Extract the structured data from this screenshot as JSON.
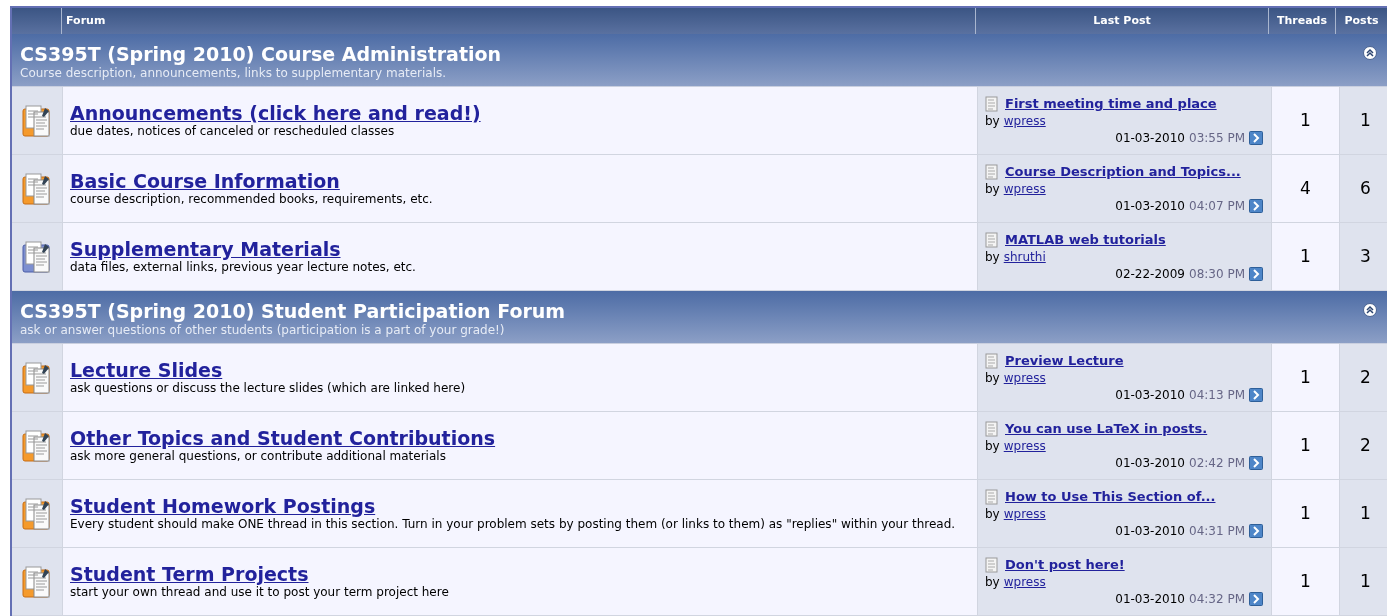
{
  "columns": [
    "Forum",
    "Last Post",
    "Threads",
    "Posts"
  ],
  "categories": [
    {
      "title": "CS395T (Spring 2010) Course Administration",
      "description": "Course description, announcements, links to supplementary materials.",
      "expanded": true,
      "forums": [
        {
          "title": "Announcements (click here and read!)",
          "description": "due dates, notices of canceled or rescheduled classes",
          "new_posts": true,
          "last_post": {
            "title": "First meeting time and place",
            "by": "by",
            "author": "wpress",
            "date": "01-03-2010",
            "time": "03:55 PM"
          },
          "threads": "1",
          "posts": "1"
        },
        {
          "title": "Basic Course Information",
          "description": "course description, recommended books, requirements, etc.",
          "new_posts": true,
          "last_post": {
            "title": "Course Description and Topics...",
            "by": "by",
            "author": "wpress",
            "date": "01-03-2010",
            "time": "04:07 PM"
          },
          "threads": "4",
          "posts": "6"
        },
        {
          "title": "Supplementary Materials",
          "description": "data files, external links, previous year lecture notes, etc.",
          "new_posts": false,
          "last_post": {
            "title": "MATLAB web tutorials",
            "by": "by",
            "author": "shruthi",
            "date": "02-22-2009",
            "time": "08:30 PM"
          },
          "threads": "1",
          "posts": "3"
        }
      ]
    },
    {
      "title": "CS395T (Spring 2010) Student Participation Forum",
      "description": "ask or answer questions of other students (participation is a part of your grade!)",
      "expanded": true,
      "forums": [
        {
          "title": "Lecture Slides",
          "description": "ask questions or discuss the lecture slides (which are linked here)",
          "new_posts": true,
          "last_post": {
            "title": "Preview Lecture",
            "by": "by",
            "author": "wpress",
            "date": "01-03-2010",
            "time": "04:13 PM"
          },
          "threads": "1",
          "posts": "2"
        },
        {
          "title": "Other Topics and Student Contributions",
          "description": "ask more general questions, or contribute additional materials",
          "new_posts": true,
          "last_post": {
            "title": "You can use LaTeX in posts.",
            "by": "by",
            "author": "wpress",
            "date": "01-03-2010",
            "time": "02:42 PM"
          },
          "threads": "1",
          "posts": "2"
        },
        {
          "title": "Student Homework Postings",
          "description": "Every student should make ONE thread in this section. Turn in your problem sets by posting them (or links to them) as \"replies\" within your thread.",
          "new_posts": true,
          "last_post": {
            "title": "How to Use This Section of...",
            "by": "by",
            "author": "wpress",
            "date": "01-03-2010",
            "time": "04:31 PM"
          },
          "threads": "1",
          "posts": "1"
        },
        {
          "title": "Student Term Projects",
          "description": "start your own thread and use it to post your term project here",
          "new_posts": true,
          "last_post": {
            "title": "Don't post here!",
            "by": "by",
            "author": "wpress",
            "date": "01-03-2010",
            "time": "04:32 PM"
          },
          "threads": "1",
          "posts": "1"
        }
      ]
    }
  ]
}
